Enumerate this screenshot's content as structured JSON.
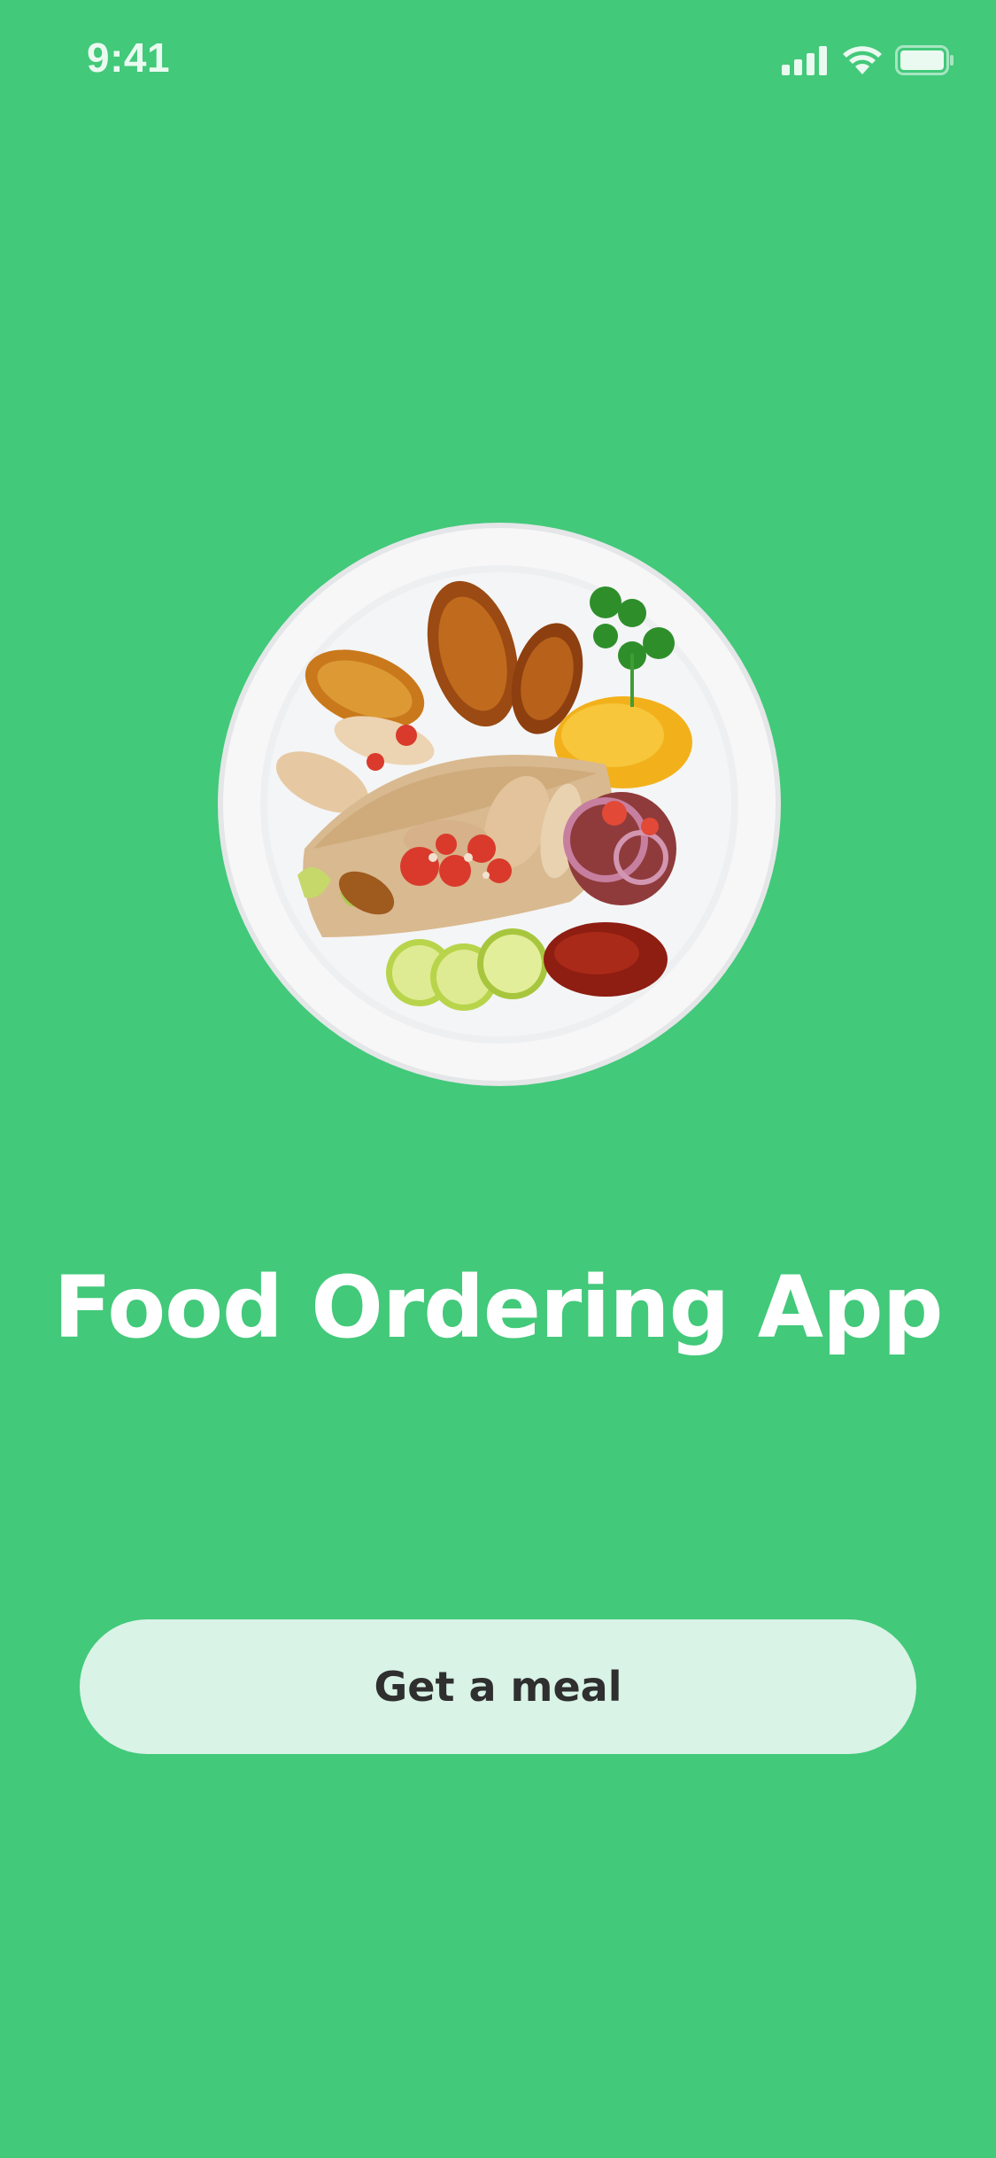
{
  "status_bar": {
    "time": "9:41",
    "icons": [
      "signal-bars-icon",
      "wifi-icon",
      "battery-icon"
    ]
  },
  "hero": {
    "image": "food-plate-image"
  },
  "title": "Food Ordering App",
  "cta": {
    "label": "Get a meal"
  },
  "colors": {
    "background": "#42c97a",
    "button_bg": "#d9f3e6",
    "button_text": "#2f2f2f",
    "title_text": "#ffffff"
  }
}
